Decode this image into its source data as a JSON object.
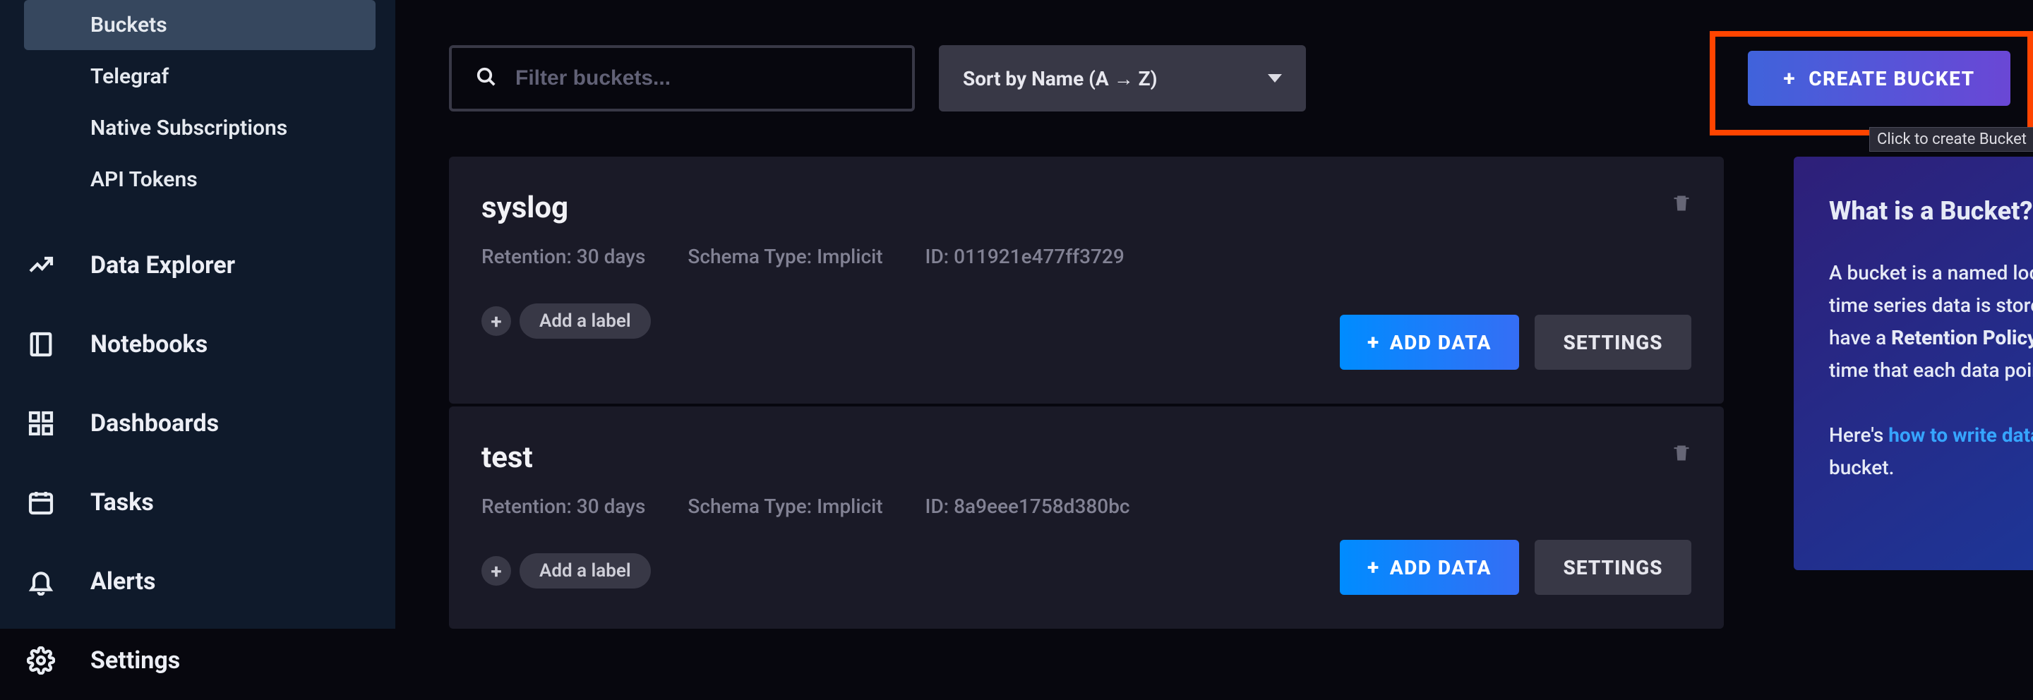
{
  "sidebar": {
    "sub": [
      {
        "label": "Buckets",
        "active": true
      },
      {
        "label": "Telegraf",
        "active": false
      },
      {
        "label": "Native Subscriptions",
        "active": false
      },
      {
        "label": "API Tokens",
        "active": false
      }
    ],
    "main": [
      {
        "label": "Data Explorer",
        "icon": "chart-line"
      },
      {
        "label": "Notebooks",
        "icon": "notebook"
      },
      {
        "label": "Dashboards",
        "icon": "grid"
      },
      {
        "label": "Tasks",
        "icon": "calendar"
      },
      {
        "label": "Alerts",
        "icon": "bell"
      },
      {
        "label": "Settings",
        "icon": "gear"
      }
    ]
  },
  "toolbar": {
    "search_placeholder": "Filter buckets...",
    "sort_label": "Sort by Name (A → Z)",
    "create_label": "CREATE BUCKET",
    "create_tooltip": "Click to create Bucket"
  },
  "buckets": [
    {
      "name": "syslog",
      "retention": "Retention: 30 days",
      "schema": "Schema Type: Implicit",
      "id": "ID: 011921e477ff3729",
      "add_label": "Add a label",
      "add_data": "ADD DATA",
      "settings": "SETTINGS"
    },
    {
      "name": "test",
      "retention": "Retention: 30 days",
      "schema": "Schema Type: Implicit",
      "id": "ID: 8a9eee1758d380bc",
      "add_label": "Add a label",
      "add_data": "ADD DATA",
      "settings": "SETTINGS"
    }
  ],
  "info": {
    "title": "What is a Bucket?",
    "p1a": "A bucket is a named location where time series data is stored. All buckets have a ",
    "p1b": "Retention Policy",
    "p1c": ", a duration of time that each data point persists.",
    "p2a": "Here's ",
    "p2b": "how to write data",
    "p2c": " into your bucket."
  }
}
